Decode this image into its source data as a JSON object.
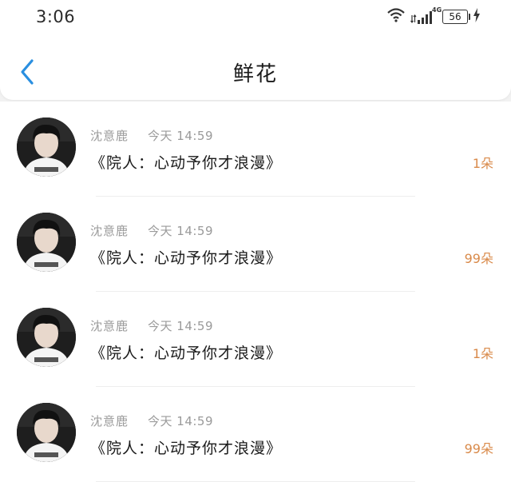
{
  "status_bar": {
    "time": "3:06",
    "network": "4G",
    "battery": "56"
  },
  "header": {
    "title": "鲜花"
  },
  "colors": {
    "back_arrow": "#2a8fe0",
    "count_text": "#d98a4a",
    "meta_text": "#9a9a9a"
  },
  "items": [
    {
      "sender": "沈意鹿",
      "time": "今天 14:59",
      "title": "《院人：心动予你才浪漫》",
      "count": "1朵"
    },
    {
      "sender": "沈意鹿",
      "time": "今天 14:59",
      "title": "《院人：心动予你才浪漫》",
      "count": "99朵"
    },
    {
      "sender": "沈意鹿",
      "time": "今天 14:59",
      "title": "《院人：心动予你才浪漫》",
      "count": "1朵"
    },
    {
      "sender": "沈意鹿",
      "time": "今天 14:59",
      "title": "《院人：心动予你才浪漫》",
      "count": "99朵"
    }
  ]
}
